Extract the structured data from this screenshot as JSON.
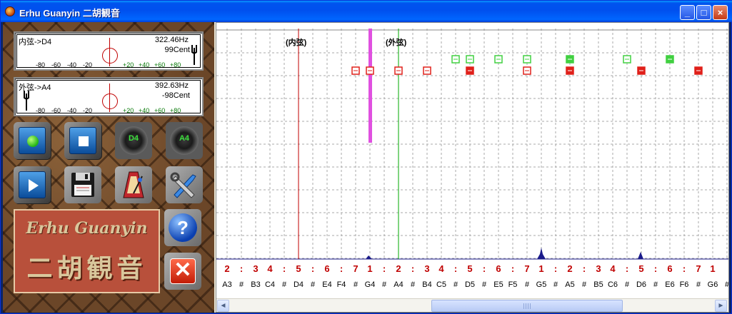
{
  "window": {
    "title": "Erhu Guanyin 二胡観音"
  },
  "meters": {
    "inner": {
      "label": "内弦->D4",
      "freq": "322.46Hz",
      "cent": "99Cent"
    },
    "outer": {
      "label": "外弦->A4",
      "freq": "392.63Hz",
      "cent": "-98Cent"
    },
    "ticks": [
      "-80",
      "-60",
      "-40",
      "-20",
      "+20",
      "+40",
      "+60",
      "+80"
    ]
  },
  "buttons": {
    "speaker_inner": "D4",
    "speaker_outer": "A4",
    "help": "?",
    "exit": "✕"
  },
  "banner": {
    "en": "Erhu Guanyin",
    "zh": "二胡観音"
  },
  "chart": {
    "inner_string_label": "(内弦)",
    "outer_string_label": "(外弦)",
    "jianpu": [
      "2",
      ":",
      "3",
      "4",
      ":",
      "5",
      ":",
      "6",
      ":",
      "7",
      "1",
      ":",
      "2",
      ":",
      "3",
      "4",
      ":",
      "5",
      ":",
      "6",
      ":",
      "7",
      "1",
      ":",
      "2",
      ":",
      "3",
      "4",
      ":",
      "5",
      ":",
      "6",
      ":",
      "7",
      "1"
    ],
    "notes": [
      "A3",
      "#",
      "B3",
      "C4",
      "#",
      "D4",
      "#",
      "E4",
      "F4",
      "#",
      "G4",
      "#",
      "A4",
      "#",
      "B4",
      "C5",
      "#",
      "D5",
      "#",
      "E5",
      "F5",
      "#",
      "G5",
      "#",
      "A5",
      "#",
      "B5",
      "C6",
      "#",
      "D6",
      "#",
      "E6",
      "F6",
      "#",
      "G6",
      "#"
    ]
  },
  "colors": {
    "inner_line": "#C00000",
    "outer_line": "#00AA00",
    "played_bar": "#E050E0",
    "marker_red": "#E0201A",
    "marker_green": "#40D040"
  }
}
